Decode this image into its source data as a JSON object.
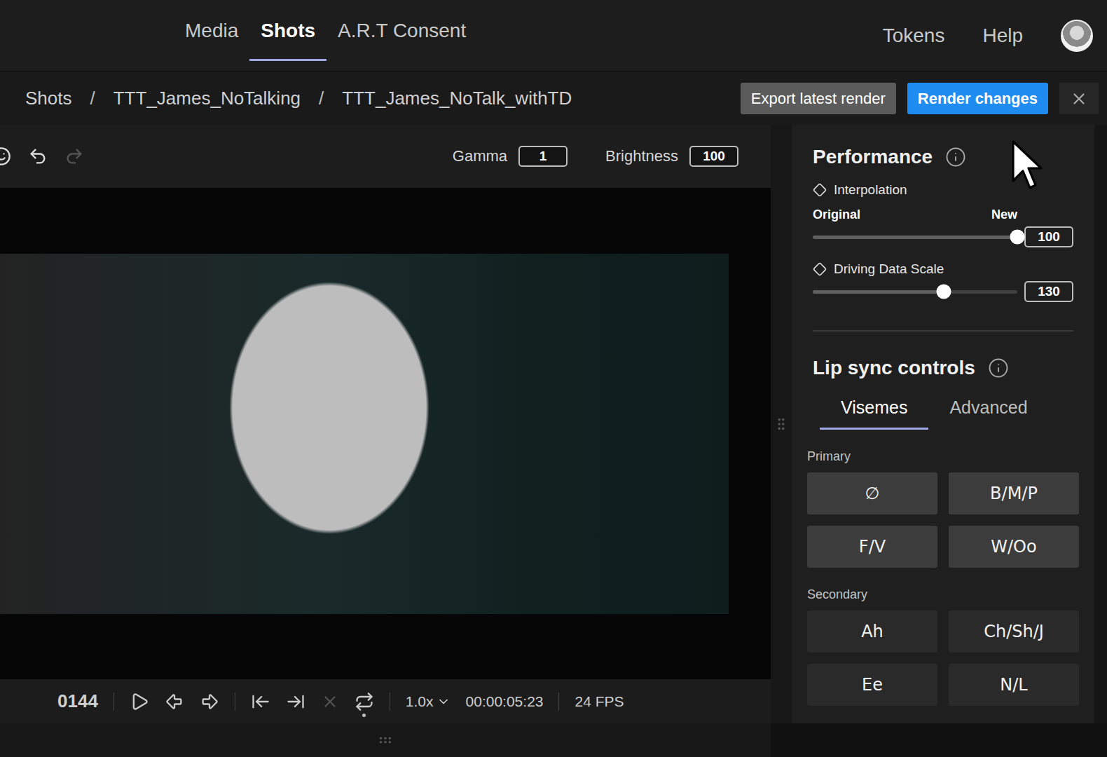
{
  "nav": {
    "tabs": [
      {
        "label": "Media",
        "selected": false
      },
      {
        "label": "Shots",
        "selected": true
      },
      {
        "label": "A.R.T Consent",
        "selected": false
      }
    ],
    "links": [
      "Tokens",
      "Help"
    ]
  },
  "breadcrumb": {
    "items": [
      "Shots",
      "TTT_James_NoTalking",
      "TTT_James_NoTalk_withTD"
    ],
    "separator": "/"
  },
  "actions": [
    {
      "label": "Export latest render",
      "kind": "secondary"
    },
    {
      "label": "Render changes",
      "kind": "primary"
    }
  ],
  "viewer": {
    "undo_enabled": true,
    "redo_enabled": false,
    "fields": [
      {
        "label": "Gamma",
        "value": "1"
      },
      {
        "label": "Brightness",
        "value": "100"
      }
    ]
  },
  "playback": {
    "frame": "0144",
    "clear_enabled": false,
    "loop_on": true,
    "speed": "1.0x",
    "timecode": "00:00:05:23",
    "fps": "24 FPS"
  },
  "performance": {
    "title": "Performance",
    "sliders": [
      {
        "label": "Interpolation",
        "left": "Original",
        "right": "New",
        "level": 1.0,
        "value": "100"
      },
      {
        "label": "Driving Data Scale",
        "left": "",
        "right": "",
        "level": 0.64,
        "value": "130"
      }
    ]
  },
  "lip_sync": {
    "title": "Lip sync controls",
    "tabs": [
      {
        "label": "Visemes",
        "selected": true
      },
      {
        "label": "Advanced",
        "selected": false
      }
    ],
    "groups": [
      {
        "label": "Primary",
        "kind": "primary",
        "items": [
          "∅",
          "B/M/P",
          "F/V",
          "W/Oo"
        ]
      },
      {
        "label": "Secondary",
        "kind": "secondary",
        "items": [
          "Ah",
          "Ch/Sh/J",
          "Ee",
          "N/L"
        ]
      }
    ]
  }
}
